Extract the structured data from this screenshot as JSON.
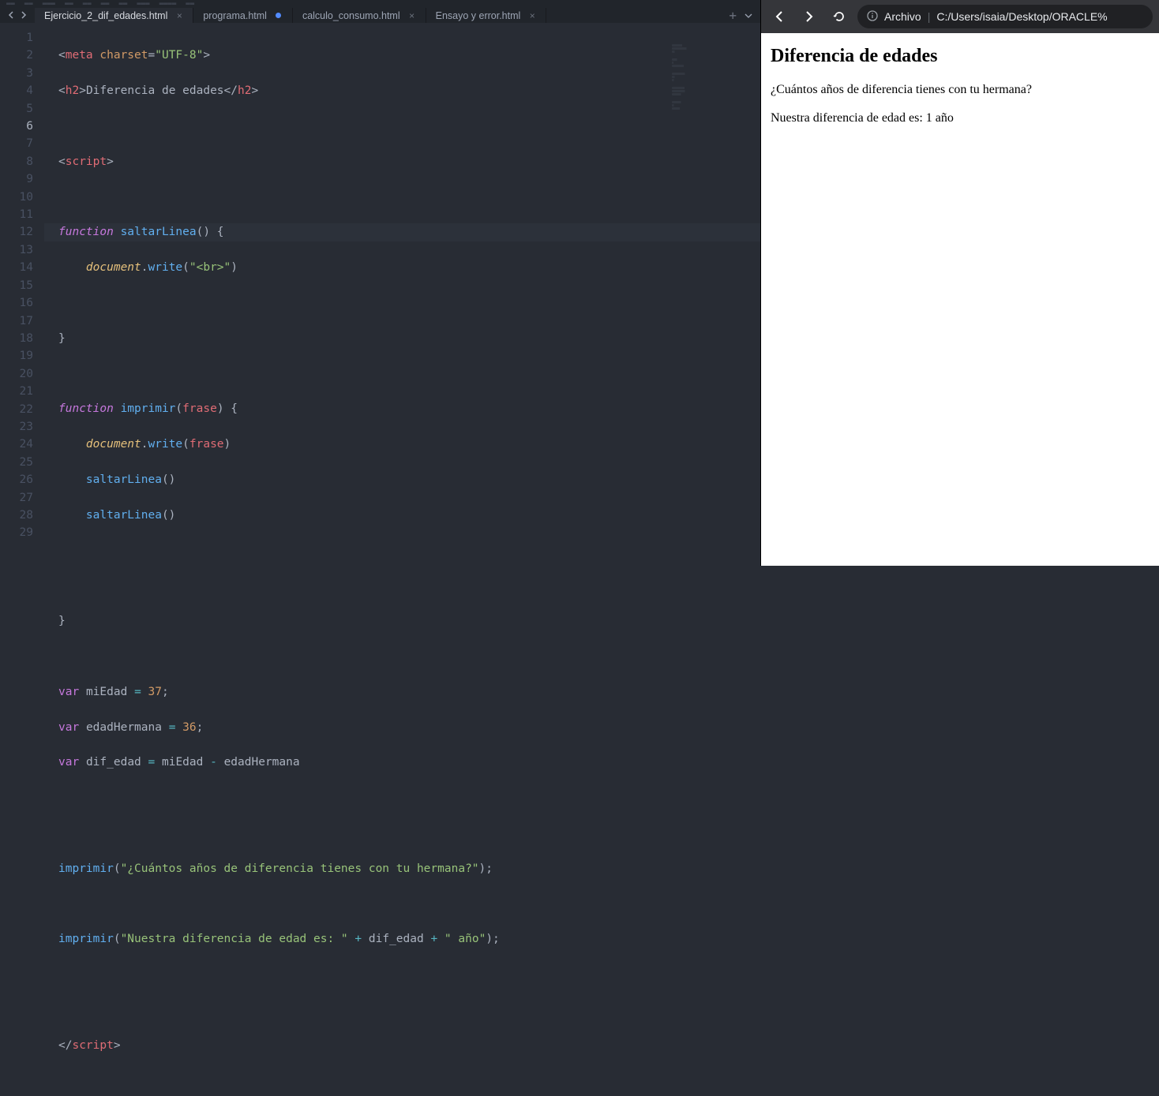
{
  "tabs": [
    {
      "label": "Ejercicio_2_dif_edades.html",
      "modified": false,
      "active": true
    },
    {
      "label": "programa.html",
      "modified": true,
      "active": false
    },
    {
      "label": "calculo_consumo.html",
      "modified": false,
      "active": false
    },
    {
      "label": "Ensayo y error.html",
      "modified": false,
      "active": false
    }
  ],
  "lines": [
    "1",
    "2",
    "3",
    "4",
    "5",
    "6",
    "7",
    "8",
    "9",
    "10",
    "11",
    "12",
    "13",
    "14",
    "15",
    "16",
    "17",
    "18",
    "19",
    "20",
    "21",
    "22",
    "23",
    "24",
    "25",
    "26",
    "27",
    "28",
    "29"
  ],
  "active_line": 6,
  "code": {
    "l1_tag": "meta",
    "l1_attr": "charset",
    "l1_val": "\"UTF-8\"",
    "l2_tag": "h2",
    "l2_text": "Diferencia de edades",
    "l4_tag": "script",
    "l6_kw": "function",
    "l6_name": "saltarLinea",
    "l7_obj": "document",
    "l7_fn": "write",
    "l7_str": "\"<br>\"",
    "l11_kw": "function",
    "l11_name": "imprimir",
    "l11_arg": "frase",
    "l12_obj": "document",
    "l12_fn": "write",
    "l12_arg": "frase",
    "l13_call": "saltarLinea",
    "l14_call": "saltarLinea",
    "l19_kw": "var",
    "l19_name": "miEdad",
    "l19_val": "37",
    "l20_kw": "var",
    "l20_name": "edadHermana",
    "l20_val": "36",
    "l21_kw": "var",
    "l21_name": "dif_edad",
    "l21_a": "miEdad",
    "l21_b": "edadHermana",
    "l24_fn": "imprimir",
    "l24_str": "\"¿Cuántos años de diferencia tienes con tu hermana?\"",
    "l26_fn": "imprimir",
    "l26_str1": "\"Nuestra diferencia de edad es: \"",
    "l26_var": "dif_edad",
    "l26_str2": "\" año\"",
    "l29_tag": "script"
  },
  "browser": {
    "scheme_label": "Archivo",
    "url": "C:/Users/isaia/Desktop/ORACLE%",
    "h2": "Diferencia de edades",
    "p1": "¿Cuántos años de diferencia tienes con tu hermana?",
    "p2": "Nuestra diferencia de edad es: 1 año"
  }
}
